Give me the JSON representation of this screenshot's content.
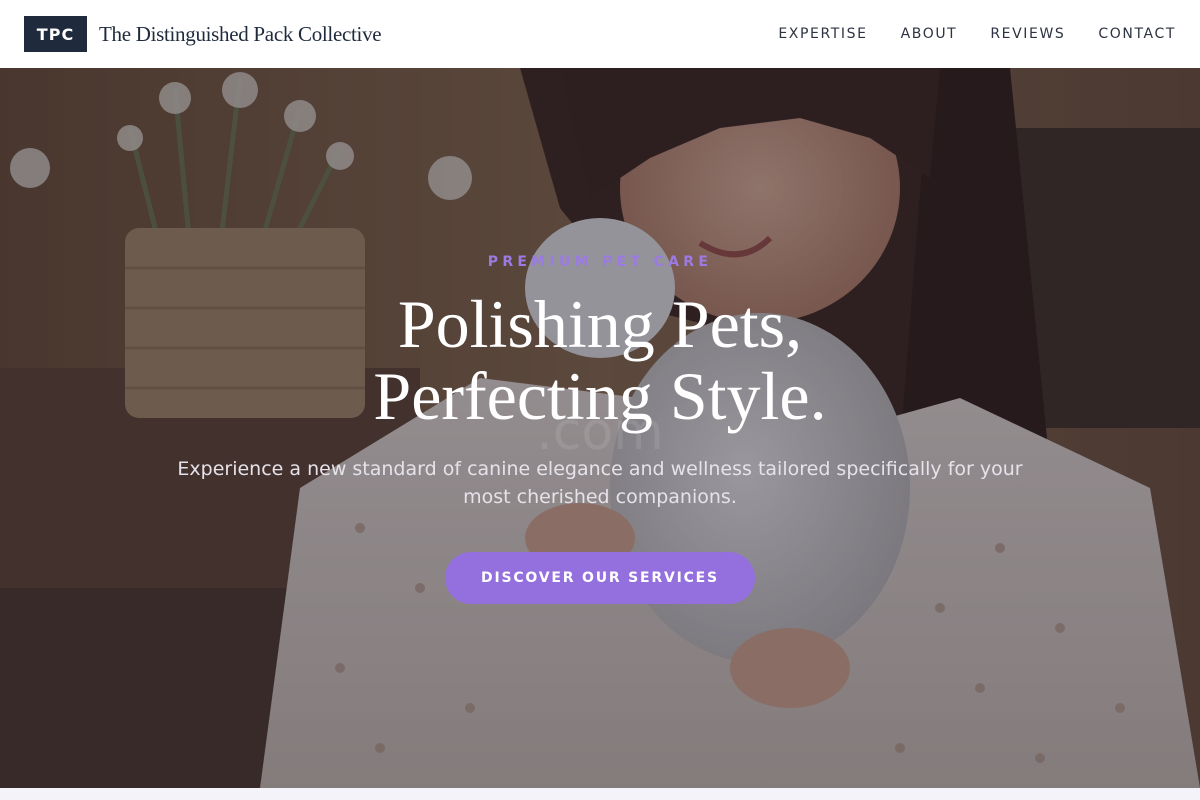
{
  "header": {
    "logo_text": "TPC",
    "brand_name": "The Distinguished Pack Collective",
    "nav": [
      {
        "label": "EXPERTISE"
      },
      {
        "label": "ABOUT"
      },
      {
        "label": "REVIEWS"
      },
      {
        "label": "CONTACT"
      }
    ]
  },
  "hero": {
    "eyebrow": "PREMIUM PET CARE",
    "title_line_1": "Polishing Pets,",
    "title_line_2": "Perfecting Style.",
    "subheading": "Experience a new standard of canine elegance and wellness tailored specifically for your most cherished companions.",
    "cta_label": "DISCOVER OUR SERVICES",
    "watermark": ".com",
    "background_image": "woman-holding-white-pet-photo"
  },
  "colors": {
    "brand_dark": "#1f2a3d",
    "accent": "#9470df",
    "eyebrow": "#9b7be3",
    "header_bg": "#ffffff"
  }
}
